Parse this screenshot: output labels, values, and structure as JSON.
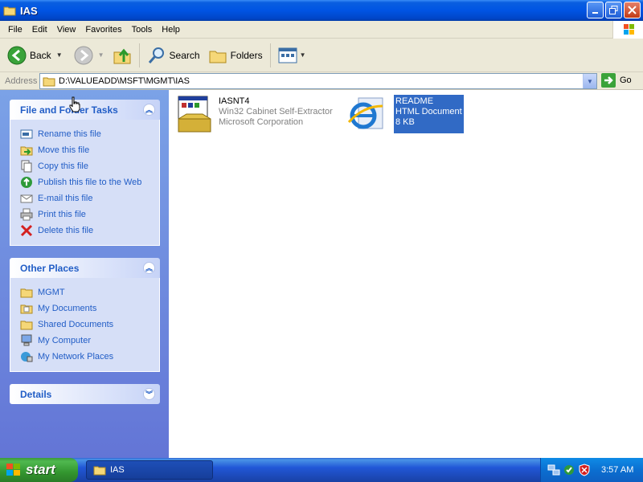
{
  "window": {
    "title": "IAS"
  },
  "menu": [
    "File",
    "Edit",
    "View",
    "Favorites",
    "Tools",
    "Help"
  ],
  "toolbar": {
    "back": "Back",
    "search": "Search",
    "folders": "Folders"
  },
  "address": {
    "label": "Address",
    "path": "D:\\VALUEADD\\MSFT\\MGMT\\IAS",
    "go": "Go"
  },
  "tasks": {
    "title": "File and Folder Tasks",
    "items": [
      {
        "label": "Rename this file",
        "icon": "rename-icon"
      },
      {
        "label": "Move this file",
        "icon": "move-icon"
      },
      {
        "label": "Copy this file",
        "icon": "copy-icon"
      },
      {
        "label": "Publish this file to the Web",
        "icon": "publish-web-icon"
      },
      {
        "label": "E-mail this file",
        "icon": "email-icon"
      },
      {
        "label": "Print this file",
        "icon": "printer-icon"
      },
      {
        "label": "Delete this file",
        "icon": "delete-icon"
      }
    ]
  },
  "places": {
    "title": "Other Places",
    "items": [
      {
        "label": "MGMT",
        "icon": "folder-icon"
      },
      {
        "label": "My Documents",
        "icon": "my-documents-icon"
      },
      {
        "label": "Shared Documents",
        "icon": "folder-icon"
      },
      {
        "label": "My Computer",
        "icon": "my-computer-icon"
      },
      {
        "label": "My Network Places",
        "icon": "network-places-icon"
      }
    ]
  },
  "details": {
    "title": "Details"
  },
  "files": [
    {
      "name": "IASNT4",
      "line2": "Win32 Cabinet Self-Extractor",
      "line3": "Microsoft Corporation",
      "icon": "installer-icon",
      "selected": false
    },
    {
      "name": "README",
      "line2": "HTML Document",
      "line3": "8 KB",
      "icon": "ie-html-icon",
      "selected": true
    }
  ],
  "taskbar": {
    "start": "start",
    "task": "IAS",
    "clock": "3:57 AM"
  }
}
